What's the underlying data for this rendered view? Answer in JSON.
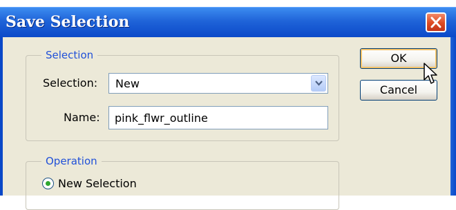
{
  "window": {
    "title": "Save Selection",
    "close_icon": "close-icon",
    "accent_color": "#0a48c8"
  },
  "selection_group": {
    "legend": "Selection",
    "selection_label": "Selection:",
    "selection_value": "New",
    "name_label": "Name:",
    "name_value": "pink_flwr_outline"
  },
  "operation_group": {
    "legend": "Operation",
    "options": [
      {
        "label": "New Selection",
        "selected": true
      }
    ]
  },
  "buttons": {
    "ok_label": "OK",
    "cancel_label": "Cancel"
  }
}
